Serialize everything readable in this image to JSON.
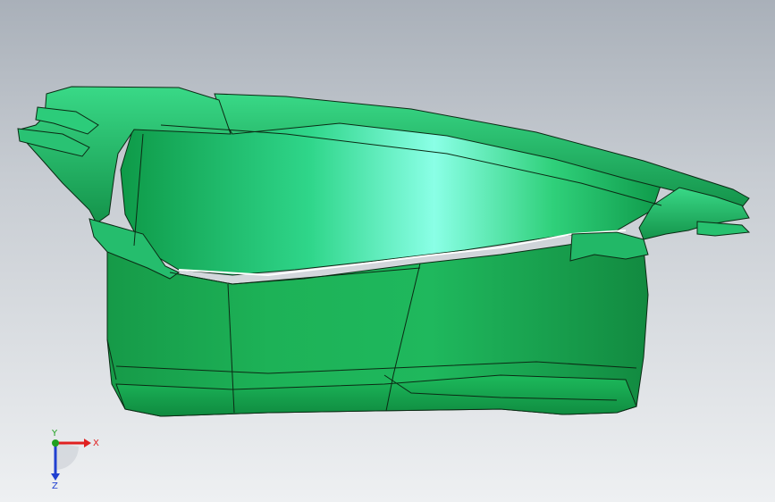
{
  "viewport": {
    "background_top": "#a9b0b9",
    "background_bottom": "#eef0f2"
  },
  "model": {
    "name": "",
    "color": "#1fbf5f",
    "highlight": "#7fffe0",
    "edge_color": "#0b2a14"
  },
  "triad": {
    "x_label": "X",
    "y_label": "Y",
    "z_label": "Z",
    "x_color": "#e02020",
    "y_color": "#20a020",
    "z_color": "#2040d0"
  }
}
